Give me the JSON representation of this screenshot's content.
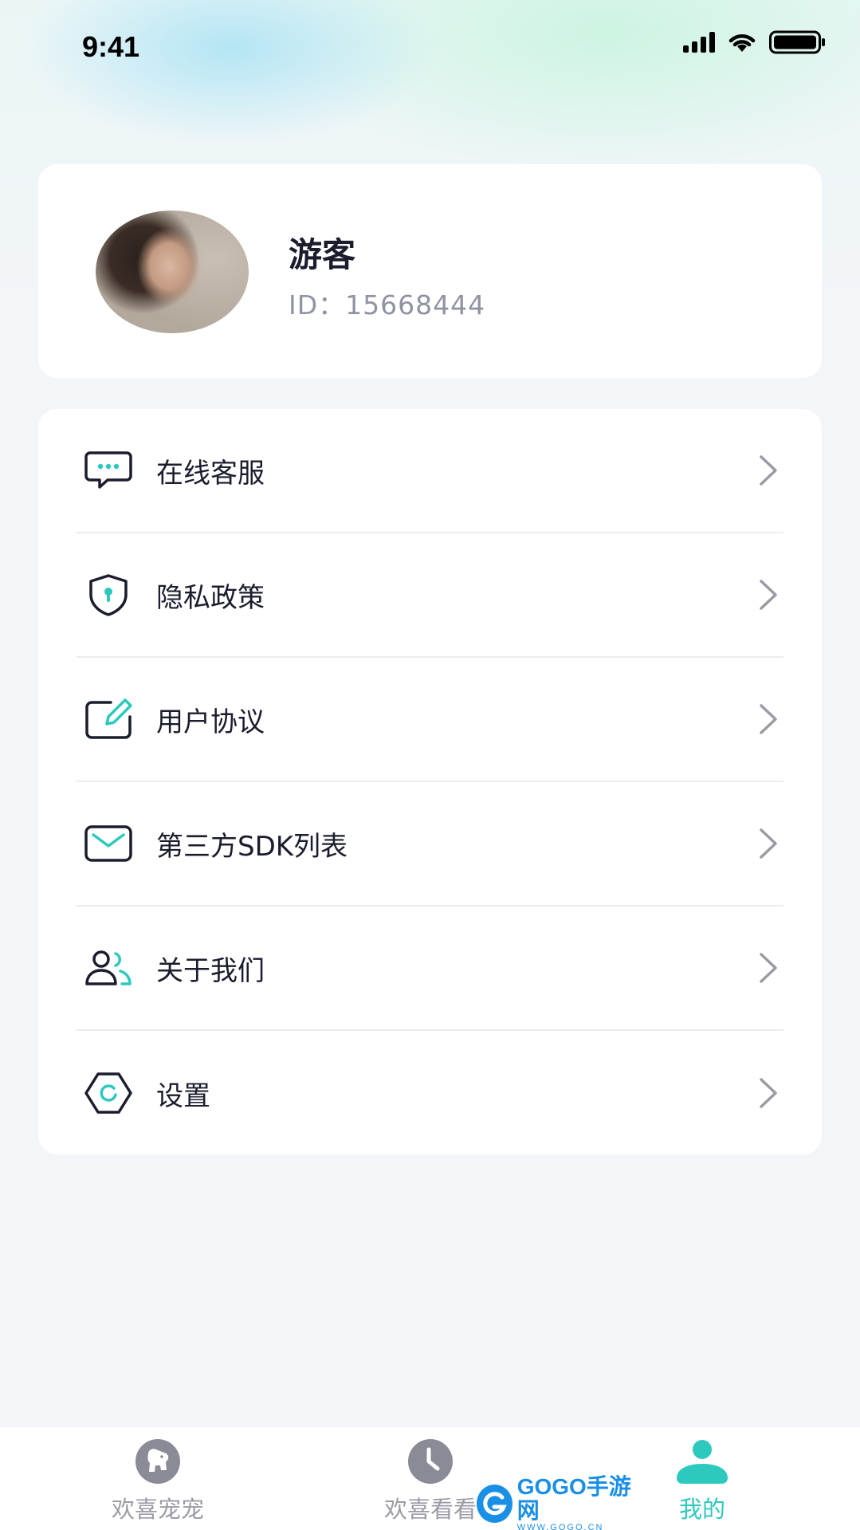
{
  "status_bar": {
    "time": "9:41"
  },
  "profile": {
    "name": "游客",
    "id_text": "ID：15668444"
  },
  "menu": {
    "items": [
      {
        "label": "在线客服",
        "icon": "chat-bubble-icon"
      },
      {
        "label": "隐私政策",
        "icon": "shield-lock-icon"
      },
      {
        "label": "用户协议",
        "icon": "edit-note-icon"
      },
      {
        "label": "第三方SDK列表",
        "icon": "mail-icon"
      },
      {
        "label": "关于我们",
        "icon": "users-icon"
      },
      {
        "label": "设置",
        "icon": "gear-icon"
      }
    ]
  },
  "tabbar": {
    "tabs": [
      {
        "label": "欢喜宠宠",
        "icon": "pet-icon",
        "active": false
      },
      {
        "label": "欢喜看看",
        "icon": "clock-icon",
        "active": false
      },
      {
        "label": "我的",
        "icon": "profile-icon",
        "active": true
      }
    ]
  },
  "watermark": {
    "main": "GOGO手游网",
    "sub": "WWW.GOGO.CN"
  },
  "colors": {
    "accent": "#2ec9be",
    "text": "#1b1d2e",
    "muted": "#8f93a3",
    "inactive_tab": "#9a9ba5"
  }
}
